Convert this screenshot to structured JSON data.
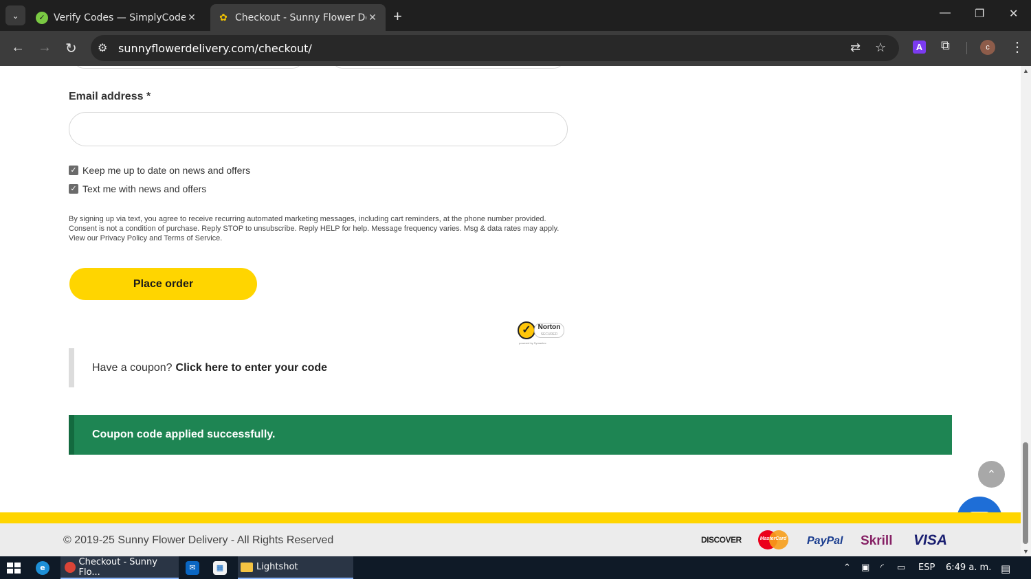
{
  "browser": {
    "tabs": [
      {
        "title": "Verify Codes — SimplyCodes",
        "favicon": "simplycodes-icon",
        "active": false
      },
      {
        "title": "Checkout - Sunny Flower Delive",
        "favicon": "sunflower-icon",
        "active": true
      }
    ],
    "new_tab": "+",
    "url": "sunnyflowerdelivery.com/checkout/",
    "profile_initial": "c",
    "extension_label": "A"
  },
  "form": {
    "email_label": "Email address *",
    "email_value": "",
    "checkbox_news": {
      "label": "Keep me up to date on news and offers",
      "checked": true
    },
    "checkbox_text": {
      "label": "Text me with news and offers",
      "checked": true
    },
    "legal_text": "By signing up via text, you agree to receive recurring automated marketing messages, including cart reminders, at the phone number provided. Consent is not a condition of purchase. Reply STOP to unsubscribe. Reply HELP for help. Message frequency varies. Msg & data rates may apply. View our Privacy Policy and Terms of Service.",
    "place_order_label": "Place order"
  },
  "norton": {
    "brand": "Norton",
    "sub": "SECURED",
    "powered": "powered by Symantec"
  },
  "coupon": {
    "prompt": "Have a coupon?",
    "link": "Click here to enter your code"
  },
  "notice": {
    "message": "Coupon code applied successfully.",
    "color": "#1e8553"
  },
  "footer": {
    "copyright": "© 2019-25 Sunny Flower Delivery - All Rights Reserved",
    "payments": [
      "DISCOVER",
      "MasterCard",
      "PayPal",
      "Skrill",
      "VISA"
    ],
    "accent": "#ffd500"
  },
  "taskbar": {
    "chrome_item": "Checkout - Sunny Flo...",
    "folder_item": "Lightshot",
    "language": "ESP",
    "time": "6:49 a. m."
  }
}
